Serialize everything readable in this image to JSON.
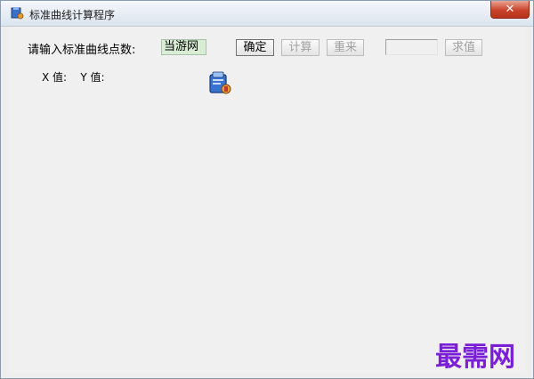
{
  "window": {
    "title": "标准曲线计算程序",
    "close_label": "✕"
  },
  "form": {
    "prompt_label": "请输入标准曲线点数:",
    "point_count_value": "当游网",
    "confirm_label": "确定",
    "calculate_label": "计算",
    "reset_label": "重来",
    "value_input": "",
    "find_label": "求值",
    "x_label": "X 值:",
    "y_label": "Y 值:"
  },
  "watermark": {
    "text": "最需网",
    "color": "#7a1fd6"
  },
  "icons": {
    "title_icon": "app-icon",
    "main_icon": "app-icon"
  }
}
